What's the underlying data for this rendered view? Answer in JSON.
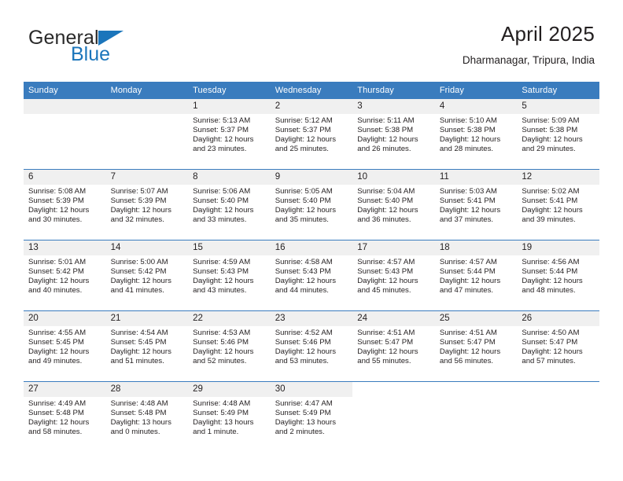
{
  "brand": {
    "name_part1": "General",
    "name_part2": "Blue",
    "flag_icon": "triangle-flag-icon"
  },
  "header": {
    "title": "April 2025",
    "subtitle": "Dharmanagar, Tripura, India"
  },
  "colors": {
    "header_blue": "#3a7cbe",
    "brand_blue": "#1b75bb",
    "daynum_band": "#f0f0f0",
    "text": "#231f20"
  },
  "weekday_headers": [
    "Sunday",
    "Monday",
    "Tuesday",
    "Wednesday",
    "Thursday",
    "Friday",
    "Saturday"
  ],
  "labels": {
    "sunrise_prefix": "Sunrise:",
    "sunset_prefix": "Sunset:",
    "daylight_prefix": "Daylight:"
  },
  "weeks": [
    [
      {
        "day": "",
        "empty": true
      },
      {
        "day": "",
        "empty": true
      },
      {
        "day": "1",
        "sunrise": "Sunrise: 5:13 AM",
        "sunset": "Sunset: 5:37 PM",
        "daylight_line1": "Daylight: 12 hours",
        "daylight_line2": "and 23 minutes."
      },
      {
        "day": "2",
        "sunrise": "Sunrise: 5:12 AM",
        "sunset": "Sunset: 5:37 PM",
        "daylight_line1": "Daylight: 12 hours",
        "daylight_line2": "and 25 minutes."
      },
      {
        "day": "3",
        "sunrise": "Sunrise: 5:11 AM",
        "sunset": "Sunset: 5:38 PM",
        "daylight_line1": "Daylight: 12 hours",
        "daylight_line2": "and 26 minutes."
      },
      {
        "day": "4",
        "sunrise": "Sunrise: 5:10 AM",
        "sunset": "Sunset: 5:38 PM",
        "daylight_line1": "Daylight: 12 hours",
        "daylight_line2": "and 28 minutes."
      },
      {
        "day": "5",
        "sunrise": "Sunrise: 5:09 AM",
        "sunset": "Sunset: 5:38 PM",
        "daylight_line1": "Daylight: 12 hours",
        "daylight_line2": "and 29 minutes."
      }
    ],
    [
      {
        "day": "6",
        "sunrise": "Sunrise: 5:08 AM",
        "sunset": "Sunset: 5:39 PM",
        "daylight_line1": "Daylight: 12 hours",
        "daylight_line2": "and 30 minutes."
      },
      {
        "day": "7",
        "sunrise": "Sunrise: 5:07 AM",
        "sunset": "Sunset: 5:39 PM",
        "daylight_line1": "Daylight: 12 hours",
        "daylight_line2": "and 32 minutes."
      },
      {
        "day": "8",
        "sunrise": "Sunrise: 5:06 AM",
        "sunset": "Sunset: 5:40 PM",
        "daylight_line1": "Daylight: 12 hours",
        "daylight_line2": "and 33 minutes."
      },
      {
        "day": "9",
        "sunrise": "Sunrise: 5:05 AM",
        "sunset": "Sunset: 5:40 PM",
        "daylight_line1": "Daylight: 12 hours",
        "daylight_line2": "and 35 minutes."
      },
      {
        "day": "10",
        "sunrise": "Sunrise: 5:04 AM",
        "sunset": "Sunset: 5:40 PM",
        "daylight_line1": "Daylight: 12 hours",
        "daylight_line2": "and 36 minutes."
      },
      {
        "day": "11",
        "sunrise": "Sunrise: 5:03 AM",
        "sunset": "Sunset: 5:41 PM",
        "daylight_line1": "Daylight: 12 hours",
        "daylight_line2": "and 37 minutes."
      },
      {
        "day": "12",
        "sunrise": "Sunrise: 5:02 AM",
        "sunset": "Sunset: 5:41 PM",
        "daylight_line1": "Daylight: 12 hours",
        "daylight_line2": "and 39 minutes."
      }
    ],
    [
      {
        "day": "13",
        "sunrise": "Sunrise: 5:01 AM",
        "sunset": "Sunset: 5:42 PM",
        "daylight_line1": "Daylight: 12 hours",
        "daylight_line2": "and 40 minutes."
      },
      {
        "day": "14",
        "sunrise": "Sunrise: 5:00 AM",
        "sunset": "Sunset: 5:42 PM",
        "daylight_line1": "Daylight: 12 hours",
        "daylight_line2": "and 41 minutes."
      },
      {
        "day": "15",
        "sunrise": "Sunrise: 4:59 AM",
        "sunset": "Sunset: 5:43 PM",
        "daylight_line1": "Daylight: 12 hours",
        "daylight_line2": "and 43 minutes."
      },
      {
        "day": "16",
        "sunrise": "Sunrise: 4:58 AM",
        "sunset": "Sunset: 5:43 PM",
        "daylight_line1": "Daylight: 12 hours",
        "daylight_line2": "and 44 minutes."
      },
      {
        "day": "17",
        "sunrise": "Sunrise: 4:57 AM",
        "sunset": "Sunset: 5:43 PM",
        "daylight_line1": "Daylight: 12 hours",
        "daylight_line2": "and 45 minutes."
      },
      {
        "day": "18",
        "sunrise": "Sunrise: 4:57 AM",
        "sunset": "Sunset: 5:44 PM",
        "daylight_line1": "Daylight: 12 hours",
        "daylight_line2": "and 47 minutes."
      },
      {
        "day": "19",
        "sunrise": "Sunrise: 4:56 AM",
        "sunset": "Sunset: 5:44 PM",
        "daylight_line1": "Daylight: 12 hours",
        "daylight_line2": "and 48 minutes."
      }
    ],
    [
      {
        "day": "20",
        "sunrise": "Sunrise: 4:55 AM",
        "sunset": "Sunset: 5:45 PM",
        "daylight_line1": "Daylight: 12 hours",
        "daylight_line2": "and 49 minutes."
      },
      {
        "day": "21",
        "sunrise": "Sunrise: 4:54 AM",
        "sunset": "Sunset: 5:45 PM",
        "daylight_line1": "Daylight: 12 hours",
        "daylight_line2": "and 51 minutes."
      },
      {
        "day": "22",
        "sunrise": "Sunrise: 4:53 AM",
        "sunset": "Sunset: 5:46 PM",
        "daylight_line1": "Daylight: 12 hours",
        "daylight_line2": "and 52 minutes."
      },
      {
        "day": "23",
        "sunrise": "Sunrise: 4:52 AM",
        "sunset": "Sunset: 5:46 PM",
        "daylight_line1": "Daylight: 12 hours",
        "daylight_line2": "and 53 minutes."
      },
      {
        "day": "24",
        "sunrise": "Sunrise: 4:51 AM",
        "sunset": "Sunset: 5:47 PM",
        "daylight_line1": "Daylight: 12 hours",
        "daylight_line2": "and 55 minutes."
      },
      {
        "day": "25",
        "sunrise": "Sunrise: 4:51 AM",
        "sunset": "Sunset: 5:47 PM",
        "daylight_line1": "Daylight: 12 hours",
        "daylight_line2": "and 56 minutes."
      },
      {
        "day": "26",
        "sunrise": "Sunrise: 4:50 AM",
        "sunset": "Sunset: 5:47 PM",
        "daylight_line1": "Daylight: 12 hours",
        "daylight_line2": "and 57 minutes."
      }
    ],
    [
      {
        "day": "27",
        "sunrise": "Sunrise: 4:49 AM",
        "sunset": "Sunset: 5:48 PM",
        "daylight_line1": "Daylight: 12 hours",
        "daylight_line2": "and 58 minutes."
      },
      {
        "day": "28",
        "sunrise": "Sunrise: 4:48 AM",
        "sunset": "Sunset: 5:48 PM",
        "daylight_line1": "Daylight: 13 hours",
        "daylight_line2": "and 0 minutes."
      },
      {
        "day": "29",
        "sunrise": "Sunrise: 4:48 AM",
        "sunset": "Sunset: 5:49 PM",
        "daylight_line1": "Daylight: 13 hours",
        "daylight_line2": "and 1 minute."
      },
      {
        "day": "30",
        "sunrise": "Sunrise: 4:47 AM",
        "sunset": "Sunset: 5:49 PM",
        "daylight_line1": "Daylight: 13 hours",
        "daylight_line2": "and 2 minutes."
      },
      {
        "day": "",
        "empty": true,
        "blank": true
      },
      {
        "day": "",
        "empty": true,
        "blank": true
      },
      {
        "day": "",
        "empty": true,
        "blank": true
      }
    ]
  ]
}
